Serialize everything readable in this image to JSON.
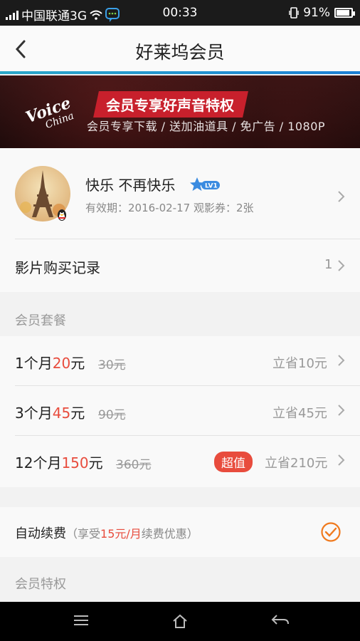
{
  "status_bar": {
    "network_small": "3G",
    "carrier": "中国联通3G",
    "time": "00:33",
    "battery": "91%"
  },
  "header": {
    "title": "好莱坞会员"
  },
  "banner": {
    "headline": "会员专享好声音特权",
    "subline": "会员专享下载 / 送加油道具 / 免广告 / 1080P",
    "logo_text": "Voice China"
  },
  "profile": {
    "name": "快乐 不再快乐",
    "level": "LV1",
    "meta": "有效期：2016-02-17   观影券：2张"
  },
  "purchase_record": {
    "label": "影片购买记录",
    "count": "1"
  },
  "plans_section": {
    "label": "会员套餐"
  },
  "plans": [
    {
      "name_prefix": "1个月",
      "price": "20",
      "unit": "元",
      "old": "30元",
      "save": "立省10元",
      "tag": ""
    },
    {
      "name_prefix": "3个月",
      "price": "45",
      "unit": "元",
      "old": "90元",
      "save": "立省45元",
      "tag": ""
    },
    {
      "name_prefix": "12个月",
      "price": "150",
      "unit": "元",
      "old": "360元",
      "save": "立省210元",
      "tag": "超值"
    }
  ],
  "auto_renew": {
    "label": "自动续费",
    "hint_prefix": "（享受",
    "hint_price": "15元/月",
    "hint_suffix": "续费优惠）",
    "checked": true
  },
  "privileges_section": {
    "label": "会员特权"
  },
  "colors": {
    "accent_red": "#e84c3d",
    "check_orange": "#f07a1e",
    "header_bar": "#2aa8c9"
  }
}
